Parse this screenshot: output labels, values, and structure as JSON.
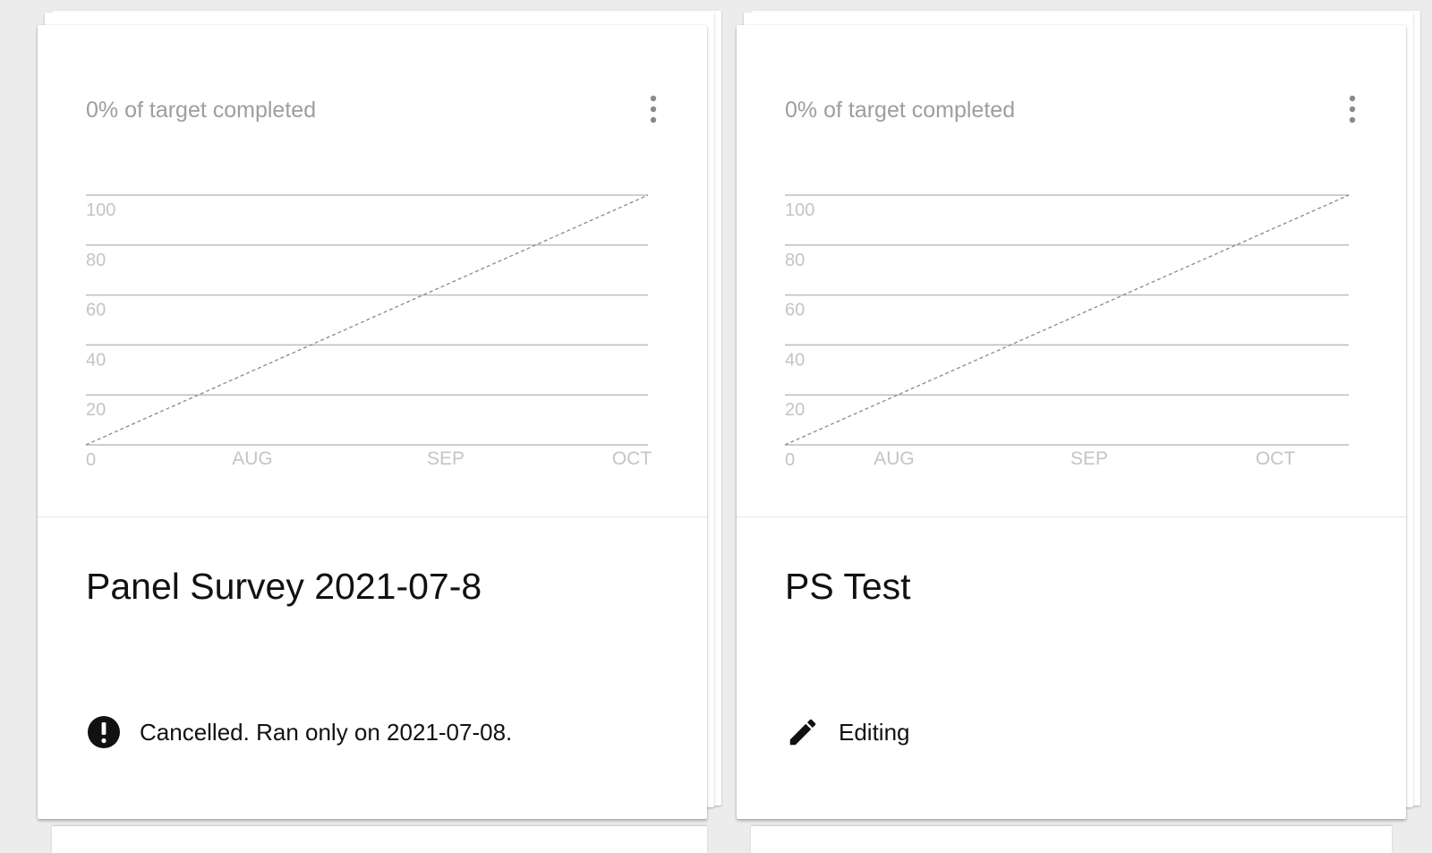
{
  "cards": [
    {
      "progress_label": "0% of target completed",
      "title": "Panel Survey 2021-07-8",
      "status_icon": "alert-circle-icon",
      "status_text": "Cancelled. Ran only on 2021-07-08.",
      "chart_data": {
        "type": "line",
        "y_ticks": [
          "100",
          "80",
          "60",
          "40",
          "20",
          "0"
        ],
        "x_ticks": [
          "AUG",
          "SEP",
          "OCT"
        ],
        "ylim": [
          0,
          100
        ],
        "grid": true,
        "series": [
          {
            "style": "dashed",
            "color": "#8a8a8a",
            "values": [
              0,
              100
            ]
          }
        ]
      }
    },
    {
      "progress_label": "0% of target completed",
      "title": "PS Test",
      "status_icon": "pencil-icon",
      "status_text": "Editing",
      "chart_data": {
        "type": "line",
        "y_ticks": [
          "100",
          "80",
          "60",
          "40",
          "20",
          "0"
        ],
        "x_ticks": [
          "AUG",
          "SEP",
          "OCT"
        ],
        "ylim": [
          0,
          100
        ],
        "grid": true,
        "series": [
          {
            "style": "dashed",
            "color": "#8a8a8a",
            "values": [
              0,
              100
            ]
          }
        ]
      }
    }
  ],
  "colors": {
    "background": "#ececec",
    "card": "#ffffff",
    "muted_text": "#9e9e9e",
    "grid_line": "#bdbdbd",
    "tick_text": "#c4c4c4",
    "primary_text": "#111111"
  },
  "icons": {
    "menu": "more-vert-icon"
  }
}
